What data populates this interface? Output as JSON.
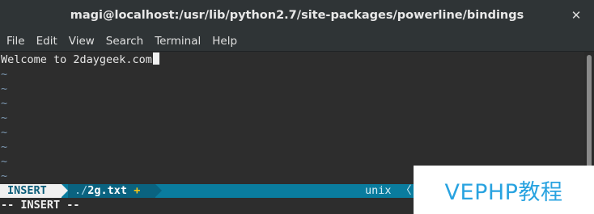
{
  "window": {
    "title": "magi@localhost:/usr/lib/python2.7/site-packages/powerline/bindings",
    "close_glyph": "✕"
  },
  "menu": {
    "items": [
      "File",
      "Edit",
      "View",
      "Search",
      "Terminal",
      "Help"
    ]
  },
  "editor": {
    "lines": [
      "Welcome to 2daygeek.com"
    ],
    "empty_line_marker": "~",
    "empty_line_count": 8
  },
  "statusline": {
    "mode": "INSERT",
    "file_dir": "./",
    "file_name": "2g.txt",
    "modified_mark": "+",
    "file_format": "unix",
    "separator": "〈"
  },
  "modeline": {
    "text": "-- INSERT --"
  },
  "watermark": {
    "text": "VEPHP教程"
  },
  "colors": {
    "statusline_bg": "#0a7c9e",
    "mode_bg": "#f0f0f0",
    "tilde": "#7d99b3",
    "modified": "#f5c518",
    "watermark_text": "#29a3e0"
  }
}
